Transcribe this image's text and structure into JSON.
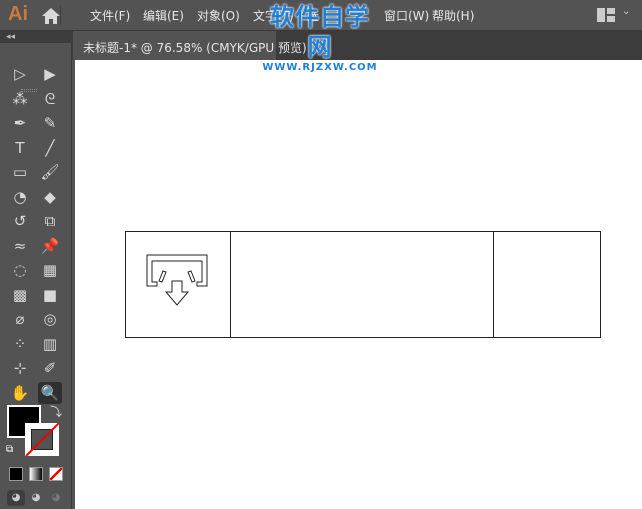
{
  "app": {
    "logo": "Ai"
  },
  "menu": [
    "文件(F)",
    "编辑(E)",
    "对象(O)",
    "文字(T)",
    "选",
    "窗口(W)",
    "帮助(H)"
  ],
  "document_tab": {
    "title": "未标题-1* @ 76.58% (CMYK/GPU 预览)"
  },
  "watermark": {
    "line1": "软件自学网",
    "line2": "WWW.RJZXW.COM"
  },
  "tools": [
    {
      "name": "selection-tool",
      "glyph": "▷"
    },
    {
      "name": "direct-selection-tool",
      "glyph": "▶"
    },
    {
      "name": "magic-wand-tool",
      "glyph": "⁂"
    },
    {
      "name": "lasso-tool",
      "glyph": "ᘓ"
    },
    {
      "name": "pen-tool",
      "glyph": "✒"
    },
    {
      "name": "curvature-tool",
      "glyph": "✎"
    },
    {
      "name": "type-tool",
      "glyph": "T"
    },
    {
      "name": "line-tool",
      "glyph": "╱"
    },
    {
      "name": "rectangle-tool",
      "glyph": "▭"
    },
    {
      "name": "paintbrush-tool",
      "glyph": "🖌"
    },
    {
      "name": "shaper-tool",
      "glyph": "◔"
    },
    {
      "name": "eraser-tool",
      "glyph": "◆"
    },
    {
      "name": "rotate-tool",
      "glyph": "↺"
    },
    {
      "name": "scale-tool",
      "glyph": "⧉"
    },
    {
      "name": "warp-tool",
      "glyph": "≈"
    },
    {
      "name": "puppet-warp-tool",
      "glyph": "📌"
    },
    {
      "name": "shape-builder-tool",
      "glyph": "◌"
    },
    {
      "name": "perspective-grid-tool",
      "glyph": "▦"
    },
    {
      "name": "mesh-tool",
      "glyph": "▩"
    },
    {
      "name": "gradient-tool",
      "glyph": "■"
    },
    {
      "name": "eyedropper-tool",
      "glyph": "⌀"
    },
    {
      "name": "blend-tool",
      "glyph": "◎"
    },
    {
      "name": "symbol-sprayer-tool",
      "glyph": "⁘"
    },
    {
      "name": "column-graph-tool",
      "glyph": "▥"
    },
    {
      "name": "artboard-tool",
      "glyph": "⊹"
    },
    {
      "name": "slice-tool",
      "glyph": "✐"
    },
    {
      "name": "hand-tool",
      "glyph": "✋"
    },
    {
      "name": "zoom-tool",
      "glyph": "🔍"
    }
  ],
  "colors": {
    "accent": "#1e7fd8",
    "fill": "#000000",
    "stroke_none": "#e00000"
  }
}
